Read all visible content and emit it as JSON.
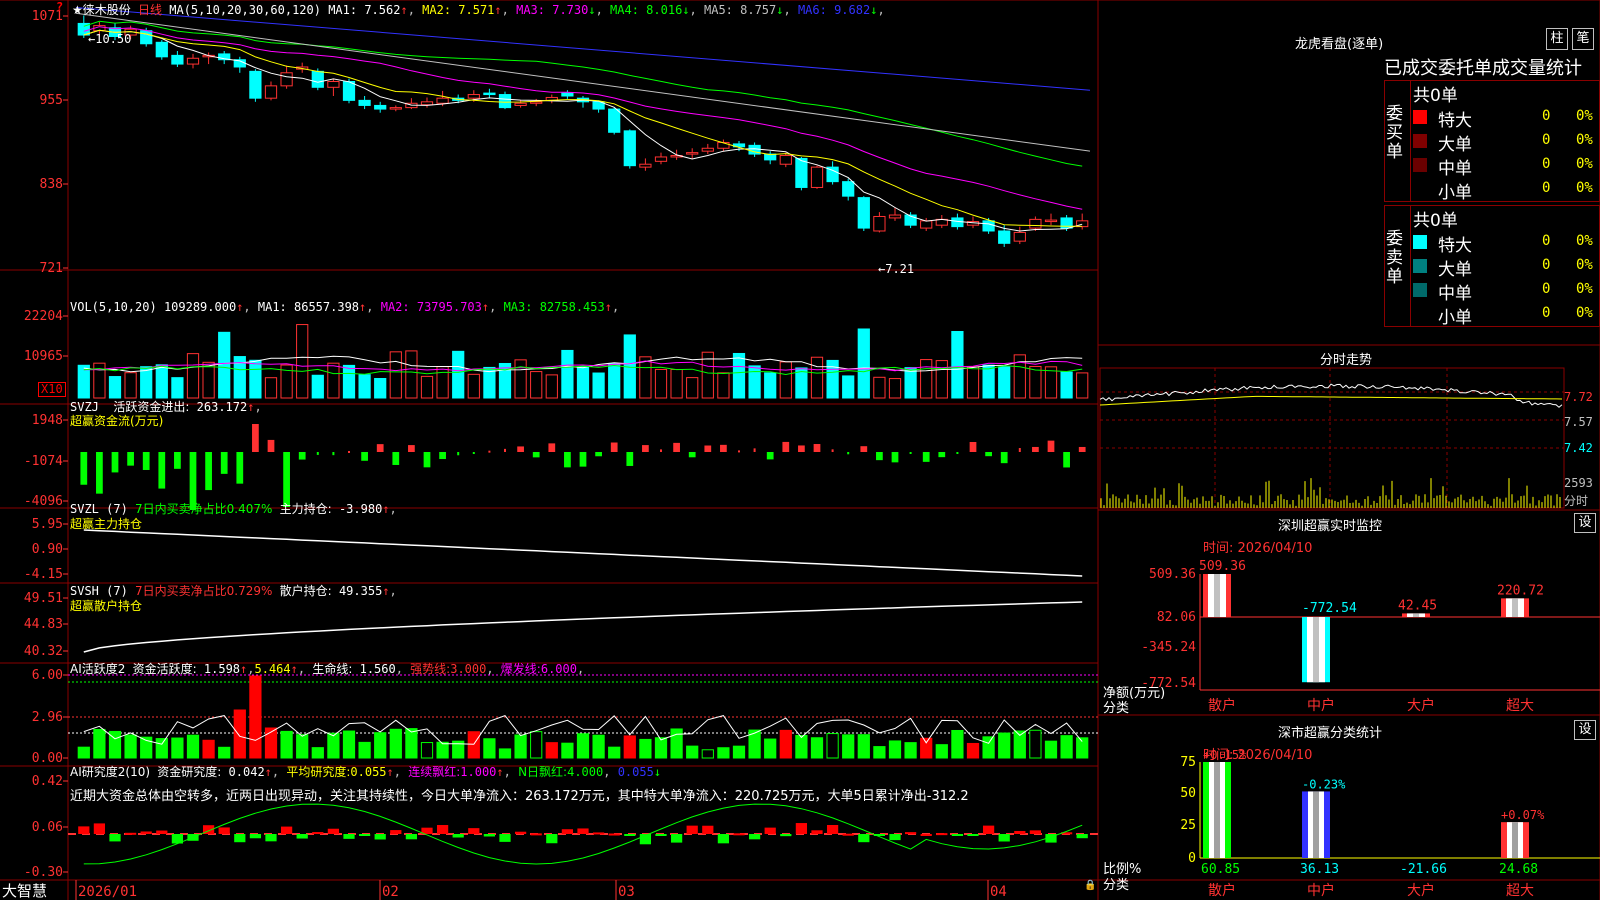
{
  "app": {
    "brand": "大智慧"
  },
  "corner_mark": "?",
  "stock_title": {
    "name": "★徕木股份",
    "period": "日线"
  },
  "main_panel": {
    "ma_header": "MA(5,10,20,30,60,120)",
    "ma_values": [
      {
        "label": "MA1:",
        "value": "7.562",
        "arrow": "↑",
        "color": "#ffffff"
      },
      {
        "label": "MA2:",
        "value": "7.571",
        "arrow": "↑",
        "color": "#ffff00"
      },
      {
        "label": "MA3:",
        "value": "7.730",
        "arrow": "↓",
        "color": "#ff00ff"
      },
      {
        "label": "MA4:",
        "value": "8.016",
        "arrow": "↓",
        "color": "#00ff00"
      },
      {
        "label": "MA5:",
        "value": "8.757",
        "arrow": "↓",
        "color": "#c0c0c0"
      },
      {
        "label": "MA6:",
        "value": "9.682",
        "arrow": "↓",
        "color": "#3232ff"
      }
    ],
    "y_labels": [
      "1071",
      "955",
      "838",
      "721"
    ],
    "high_mark": "←10.50",
    "low_mark": "←7.21",
    "y_axis": {
      "max": 10.71,
      "min": 7.21
    }
  },
  "vol_panel": {
    "header": "VOL(5,10,20)",
    "value": "109289.000",
    "ma": [
      {
        "label": "MA1:",
        "value": "86557.398",
        "color": "#ffffff"
      },
      {
        "label": "MA2:",
        "value": "73795.703",
        "color": "#ff00ff"
      },
      {
        "label": "MA3:",
        "value": "82758.453",
        "color": "#00ff00"
      }
    ],
    "y_labels": [
      "22204",
      "10965"
    ],
    "unit": "X10"
  },
  "svzj_panel": {
    "header": "SVZJ",
    "label": "活跃资金进出:",
    "value": "263.172",
    "subtitle": "超赢资金流(万元)",
    "y_labels": [
      "1948",
      "-1074",
      "-4096"
    ]
  },
  "svzl_panel": {
    "header": "SVZL (7)",
    "label_green": "7日内买卖净占比0.407%",
    "label": "主力持仓:",
    "value": "-3.980",
    "subtitle": "超赢主力持仓",
    "y_labels": [
      "5.95",
      "0.90",
      "-4.15"
    ]
  },
  "svsh_panel": {
    "header": "SVSH (7)",
    "label_red": "7日内买卖净占比0.729%",
    "label": "散户持仓:",
    "value": "49.355",
    "subtitle": "超赢散户持仓",
    "y_labels": [
      "49.51",
      "44.83",
      "40.32"
    ]
  },
  "ai_active_panel": {
    "header": "AI活跃度2",
    "label": "资金活跃度:",
    "value": "1.598",
    "value2": "5.464",
    "life_label": "生命线:",
    "life_value": "1.560",
    "strong_label": "强势线:",
    "strong_value": "3.000",
    "burst_label": "爆发线:",
    "burst_value": "6.000",
    "y_labels": [
      "6.00",
      "2.96",
      "0.00"
    ]
  },
  "ai_research_panel": {
    "header": "AI研究度2(10)",
    "label": "资金研究度:",
    "value": "0.042",
    "avg_label": "平均研究度:",
    "avg_value": "0.055",
    "cont_label": "连续飘红:",
    "cont_value": "1.000",
    "n_label": "N日飘红:",
    "n_value": "4.000",
    "last_value": "0.055",
    "comment": "近期大资金总体由空转多，近两日出现异动，关注其持续性，今日大单净流入：263.172万元，其中特大单净流入：220.725万元，大单5日累计净出-312.2",
    "y_labels": [
      "0.42",
      "0.06",
      "-0.30"
    ]
  },
  "x_axis": {
    "labels": [
      "2026/01",
      "02",
      "03",
      "04"
    ]
  },
  "dragon_tiger": {
    "title": "龙虎看盘(逐单)",
    "btn1": "柱",
    "btn2": "笔",
    "subtitle": "已成交委托单成交量统计",
    "buy": {
      "side_label": "委买单",
      "total": "共0单",
      "rows": [
        {
          "label": "特大",
          "count": "0",
          "pct": "0%",
          "color": "#ff0000"
        },
        {
          "label": "大单",
          "count": "0",
          "pct": "0%",
          "color": "#800000"
        },
        {
          "label": "中单",
          "count": "0",
          "pct": "0%",
          "color": "#6a0000"
        },
        {
          "label": "小单",
          "count": "0",
          "pct": "0%",
          "color": "#000000"
        }
      ]
    },
    "sell": {
      "side_label": "委卖单",
      "total": "共0单",
      "rows": [
        {
          "label": "特大",
          "count": "0",
          "pct": "0%",
          "color": "#00ffff"
        },
        {
          "label": "大单",
          "count": "0",
          "pct": "0%",
          "color": "#008080"
        },
        {
          "label": "中单",
          "count": "0",
          "pct": "0%",
          "color": "#006a6a"
        },
        {
          "label": "小单",
          "count": "0",
          "pct": "0%",
          "color": "#000000"
        }
      ]
    }
  },
  "intraday": {
    "title": "分时走势",
    "prices": [
      "7.72",
      "7.57",
      "7.42"
    ],
    "vol": "2593",
    "vol_label": "分时"
  },
  "sz_monitor": {
    "title": "深圳超赢实时监控",
    "settings": "设",
    "time_label": "时间: 2026/04/10",
    "y_labels": [
      "509.36",
      "82.06",
      "-345.24",
      "-772.54"
    ],
    "axis_title": "净额(万元)",
    "axis_sub": "分类",
    "categories": [
      "散户",
      "中户",
      "大户",
      "超大"
    ],
    "values": [
      "509.36",
      "-772.54",
      "42.45",
      "220.72"
    ]
  },
  "sz_class": {
    "title": "深市超赢分类统计",
    "settings": "设",
    "time_label": "时间: 2026/04/10",
    "y_labels": [
      "75",
      "50",
      "25",
      "0"
    ],
    "axis_title": "比例%",
    "axis_sub": "分类",
    "categories": [
      "散户",
      "中户",
      "大户",
      "超大"
    ],
    "top_pcts": [
      "+0.15%",
      "-0.23%",
      "",
      "+0.07%"
    ],
    "bottom_values": [
      "60.85",
      "36.13",
      "-21.66",
      "24.68"
    ]
  },
  "chart_data": {
    "type": "candlestick",
    "title": "★徕木股份 日线",
    "candles": [
      {
        "o": 10.58,
        "c": 10.42,
        "h": 10.69,
        "l": 10.38
      },
      {
        "o": 10.48,
        "c": 10.55,
        "h": 10.6,
        "l": 10.4
      },
      {
        "o": 10.52,
        "c": 10.4,
        "h": 10.58,
        "l": 10.35
      },
      {
        "o": 10.42,
        "c": 10.5,
        "h": 10.55,
        "l": 10.36
      },
      {
        "o": 10.48,
        "c": 10.3,
        "h": 10.52,
        "l": 10.26
      },
      {
        "o": 10.32,
        "c": 10.12,
        "h": 10.35,
        "l": 10.08
      },
      {
        "o": 10.14,
        "c": 10.02,
        "h": 10.2,
        "l": 9.98
      },
      {
        "o": 10.02,
        "c": 10.1,
        "h": 10.16,
        "l": 9.96
      },
      {
        "o": 10.12,
        "c": 10.14,
        "h": 10.18,
        "l": 10.02
      },
      {
        "o": 10.16,
        "c": 10.08,
        "h": 10.2,
        "l": 10.02
      },
      {
        "o": 10.08,
        "c": 9.98,
        "h": 10.12,
        "l": 9.9
      },
      {
        "o": 9.92,
        "c": 9.55,
        "h": 9.95,
        "l": 9.5
      },
      {
        "o": 9.55,
        "c": 9.72,
        "h": 9.78,
        "l": 9.52
      },
      {
        "o": 9.72,
        "c": 9.9,
        "h": 10.0,
        "l": 9.68
      },
      {
        "o": 9.95,
        "c": 9.98,
        "h": 10.04,
        "l": 9.9
      },
      {
        "o": 9.92,
        "c": 9.7,
        "h": 9.96,
        "l": 9.66
      },
      {
        "o": 9.7,
        "c": 9.78,
        "h": 9.82,
        "l": 9.58
      },
      {
        "o": 9.78,
        "c": 9.52,
        "h": 9.82,
        "l": 9.48
      },
      {
        "o": 9.52,
        "c": 9.45,
        "h": 9.58,
        "l": 9.4
      },
      {
        "o": 9.45,
        "c": 9.4,
        "h": 9.5,
        "l": 9.35
      },
      {
        "o": 9.4,
        "c": 9.42,
        "h": 9.45,
        "l": 9.37
      },
      {
        "o": 9.42,
        "c": 9.48,
        "h": 9.55,
        "l": 9.4
      },
      {
        "o": 9.46,
        "c": 9.5,
        "h": 9.56,
        "l": 9.42
      },
      {
        "o": 9.48,
        "c": 9.55,
        "h": 9.65,
        "l": 9.44
      },
      {
        "o": 9.55,
        "c": 9.52,
        "h": 9.6,
        "l": 9.48
      },
      {
        "o": 9.55,
        "c": 9.6,
        "h": 9.66,
        "l": 9.5
      },
      {
        "o": 9.62,
        "c": 9.6,
        "h": 9.68,
        "l": 9.55
      },
      {
        "o": 9.6,
        "c": 9.42,
        "h": 9.64,
        "l": 9.4
      },
      {
        "o": 9.45,
        "c": 9.48,
        "h": 9.52,
        "l": 9.42
      },
      {
        "o": 9.48,
        "c": 9.5,
        "h": 9.54,
        "l": 9.44
      },
      {
        "o": 9.52,
        "c": 9.56,
        "h": 9.6,
        "l": 9.48
      },
      {
        "o": 9.62,
        "c": 9.58,
        "h": 9.66,
        "l": 9.54
      },
      {
        "o": 9.55,
        "c": 9.5,
        "h": 9.58,
        "l": 9.42
      },
      {
        "o": 9.5,
        "c": 9.4,
        "h": 9.52,
        "l": 9.35
      },
      {
        "o": 9.4,
        "c": 9.08,
        "h": 9.42,
        "l": 9.05
      },
      {
        "o": 9.1,
        "c": 8.62,
        "h": 9.12,
        "l": 8.58
      },
      {
        "o": 8.6,
        "c": 8.64,
        "h": 8.72,
        "l": 8.55
      },
      {
        "o": 8.68,
        "c": 8.74,
        "h": 8.8,
        "l": 8.64
      },
      {
        "o": 8.74,
        "c": 8.76,
        "h": 8.84,
        "l": 8.7
      },
      {
        "o": 8.78,
        "c": 8.8,
        "h": 8.86,
        "l": 8.72
      },
      {
        "o": 8.82,
        "c": 8.86,
        "h": 8.92,
        "l": 8.78
      },
      {
        "o": 8.86,
        "c": 8.94,
        "h": 8.98,
        "l": 8.82
      },
      {
        "o": 8.92,
        "c": 8.88,
        "h": 8.96,
        "l": 8.82
      },
      {
        "o": 8.9,
        "c": 8.78,
        "h": 8.94,
        "l": 8.74
      },
      {
        "o": 8.78,
        "c": 8.7,
        "h": 8.82,
        "l": 8.64
      },
      {
        "o": 8.64,
        "c": 8.76,
        "h": 8.8,
        "l": 8.6
      },
      {
        "o": 8.72,
        "c": 8.32,
        "h": 8.74,
        "l": 8.28
      },
      {
        "o": 8.32,
        "c": 8.6,
        "h": 8.62,
        "l": 8.3
      },
      {
        "o": 8.6,
        "c": 8.4,
        "h": 8.68,
        "l": 8.36
      },
      {
        "o": 8.4,
        "c": 8.2,
        "h": 8.44,
        "l": 8.14
      },
      {
        "o": 8.18,
        "c": 7.76,
        "h": 8.2,
        "l": 7.72
      },
      {
        "o": 7.72,
        "c": 7.92,
        "h": 7.98,
        "l": 7.7
      },
      {
        "o": 7.9,
        "c": 7.94,
        "h": 8.04,
        "l": 7.86
      },
      {
        "o": 7.94,
        "c": 7.8,
        "h": 7.98,
        "l": 7.76
      },
      {
        "o": 7.76,
        "c": 7.86,
        "h": 7.9,
        "l": 7.72
      },
      {
        "o": 7.8,
        "c": 7.88,
        "h": 7.94,
        "l": 7.76
      },
      {
        "o": 7.9,
        "c": 7.78,
        "h": 7.96,
        "l": 7.74
      },
      {
        "o": 7.8,
        "c": 7.85,
        "h": 7.92,
        "l": 7.76
      },
      {
        "o": 7.86,
        "c": 7.72,
        "h": 7.9,
        "l": 7.68
      },
      {
        "o": 7.72,
        "c": 7.55,
        "h": 7.8,
        "l": 7.5
      },
      {
        "o": 7.58,
        "c": 7.7,
        "h": 7.78,
        "l": 7.54
      },
      {
        "o": 7.76,
        "c": 7.88,
        "h": 7.92,
        "l": 7.72
      },
      {
        "o": 7.85,
        "c": 7.87,
        "h": 7.96,
        "l": 7.8
      },
      {
        "o": 7.9,
        "c": 7.76,
        "h": 7.94,
        "l": 7.72
      },
      {
        "o": 7.78,
        "c": 7.86,
        "h": 7.96,
        "l": 7.74
      }
    ],
    "ma_lines_last": {
      "MA1": 7.562,
      "MA2": 7.571,
      "MA3": 7.73,
      "MA4": 8.016,
      "MA5": 8.757,
      "MA6": 9.682
    },
    "ylim": [
      7.21,
      10.71
    ]
  }
}
